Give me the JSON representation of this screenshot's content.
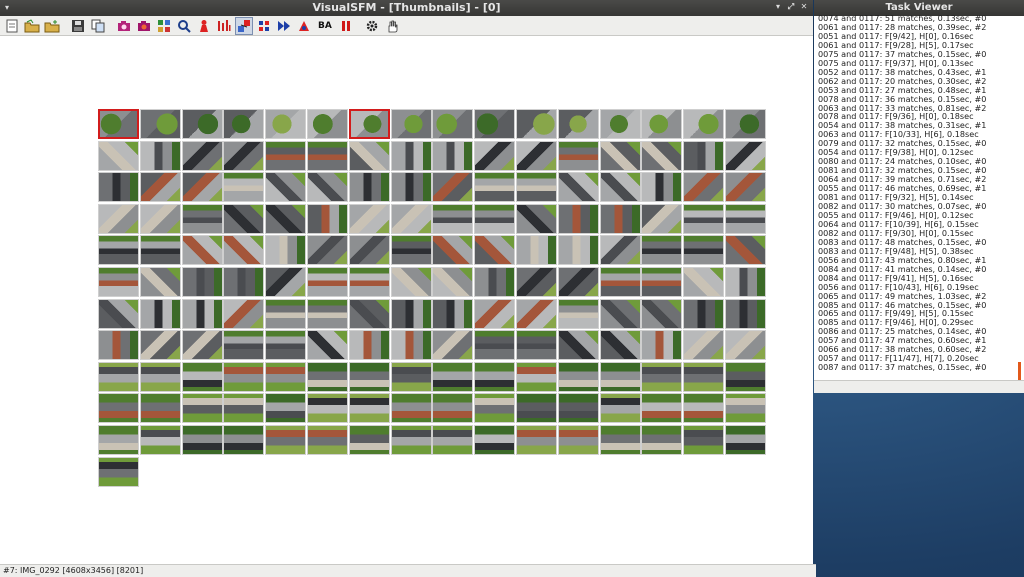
{
  "main_window": {
    "title": "VisualSFM - [Thumbnails] - [0]",
    "toolbar": {
      "ba_label": "BA",
      "icons": [
        "new-document-icon",
        "open-folder-icon",
        "open-folder-plus-icon",
        "save-icon",
        "copy-icon",
        "camera-icon",
        "camera-red-icon",
        "image-grid-icon",
        "zoom-icon",
        "person-icon",
        "pairwise-matching-icon",
        "sfm-compute-icon",
        "cluster-icon",
        "run-forward-icon",
        "dense-icon",
        "ba-icon",
        "pause-icon",
        "settings-icon",
        "pan-hand-icon"
      ]
    },
    "thumbnails": {
      "columns": 16,
      "total": 177,
      "selected": [
        0,
        6
      ]
    },
    "status": "#7: IMG_0292 [4608x3456] [8201]"
  },
  "task_viewer": {
    "title": "Task Viewer",
    "lines": [
      "0074 and 0117: 51 matches, 0.13sec, #0",
      "0061 and 0117: 28 matches, 0.39sec, #2",
      "0051 and 0117: F[9/42], H[0], 0.16sec",
      "0061 and 0117: F[9/28], H[5], 0.17sec",
      "0075 and 0117: 37 matches, 0.15sec, #0",
      "0075 and 0117: F[9/37], H[0], 0.13sec",
      "0052 and 0117: 38 matches, 0.43sec, #1",
      "0062 and 0117: 20 matches, 0.30sec, #2",
      "0053 and 0117: 27 matches, 0.48sec, #1",
      "0078 and 0117: 36 matches, 0.15sec, #0",
      "0063 and 0117: 33 matches, 0.81sec, #2",
      "0078 and 0117: F[9/36], H[0], 0.18sec",
      "0054 and 0117: 38 matches, 0.31sec, #1",
      "0063 and 0117: F[10/33], H[6], 0.18sec",
      "0079 and 0117: 32 matches, 0.15sec, #0",
      "0054 and 0117: F[9/38], H[0], 0.12sec",
      "0080 and 0117: 24 matches, 0.10sec, #0",
      "0081 and 0117: 32 matches, 0.15sec, #0",
      "0064 and 0117: 39 matches, 0.71sec, #2",
      "0055 and 0117: 46 matches, 0.69sec, #1",
      "0081 and 0117: F[9/32], H[5], 0.14sec",
      "0082 and 0117: 30 matches, 0.07sec, #0",
      "0055 and 0117: F[9/46], H[0], 0.12sec",
      "0064 and 0117: F[10/39], H[6], 0.15sec",
      "0082 and 0117: F[9/30], H[0], 0.15sec",
      "0083 and 0117: 48 matches, 0.15sec, #0",
      "0083 and 0117: F[9/48], H[5], 0.38sec",
      "0056 and 0117: 43 matches, 0.80sec, #1",
      "0084 and 0117: 41 matches, 0.14sec, #0",
      "0084 and 0117: F[9/41], H[5], 0.16sec",
      "0056 and 0117: F[10/43], H[6], 0.19sec",
      "0065 and 0117: 49 matches, 1.03sec, #2",
      "0085 and 0117: 46 matches, 0.15sec, #0",
      "0065 and 0117: F[9/49], H[5], 0.15sec",
      "0085 and 0117: F[9/46], H[0], 0.29sec",
      "0086 and 0117: 25 matches, 0.14sec, #0",
      "0057 and 0117: 47 matches, 0.60sec, #1",
      "0066 and 0117: 38 matches, 0.60sec, #2",
      "0057 and 0117: F[11/47], H[7], 0.20sec",
      "0087 and 0117: 37 matches, 0.15sec, #0"
    ]
  }
}
